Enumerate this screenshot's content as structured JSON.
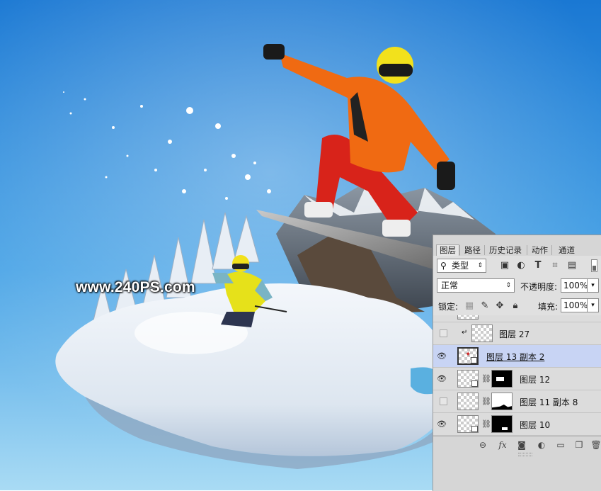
{
  "watermark": "www.240PS.com",
  "panel": {
    "tabs": [
      "图层",
      "路径",
      "历史记录",
      "动作",
      "通道"
    ],
    "active_tab": "图层",
    "filter": {
      "kind_label": "类型",
      "icons": [
        "image-filter-icon",
        "adjustment-filter-icon",
        "type-filter-icon",
        "shape-filter-icon",
        "smart-object-filter-icon"
      ]
    },
    "blend_mode": "正常",
    "opacity_label": "不透明度:",
    "opacity_value": "100%",
    "lock_label": "锁定:",
    "fill_label": "填充:",
    "fill_value": "100%",
    "layers": [
      {
        "name": "图层 27",
        "visible": false,
        "clipped": true,
        "mask": false,
        "selected": false
      },
      {
        "name": "图层 13 副本 2",
        "visible": true,
        "clipped": false,
        "mask": false,
        "selected": true
      },
      {
        "name": "图层 12",
        "visible": true,
        "clipped": false,
        "mask": true,
        "selected": false
      },
      {
        "name": "图层 11 副本 8",
        "visible": false,
        "clipped": false,
        "mask": true,
        "selected": false
      },
      {
        "name": "图层 10",
        "visible": true,
        "clipped": false,
        "mask": true,
        "selected": false
      }
    ],
    "bottom_icons": [
      "link-icon",
      "fx-icon",
      "add-mask-icon",
      "adjustment-layer-icon",
      "group-folder-icon",
      "new-layer-icon",
      "trash-icon"
    ]
  },
  "colors": {
    "sky_top": "#1d7fd8",
    "sky_bottom": "#a7d8f2",
    "jacket": "#f06a12",
    "pants": "#e0261a",
    "selected_row": "#c8d4f4"
  }
}
